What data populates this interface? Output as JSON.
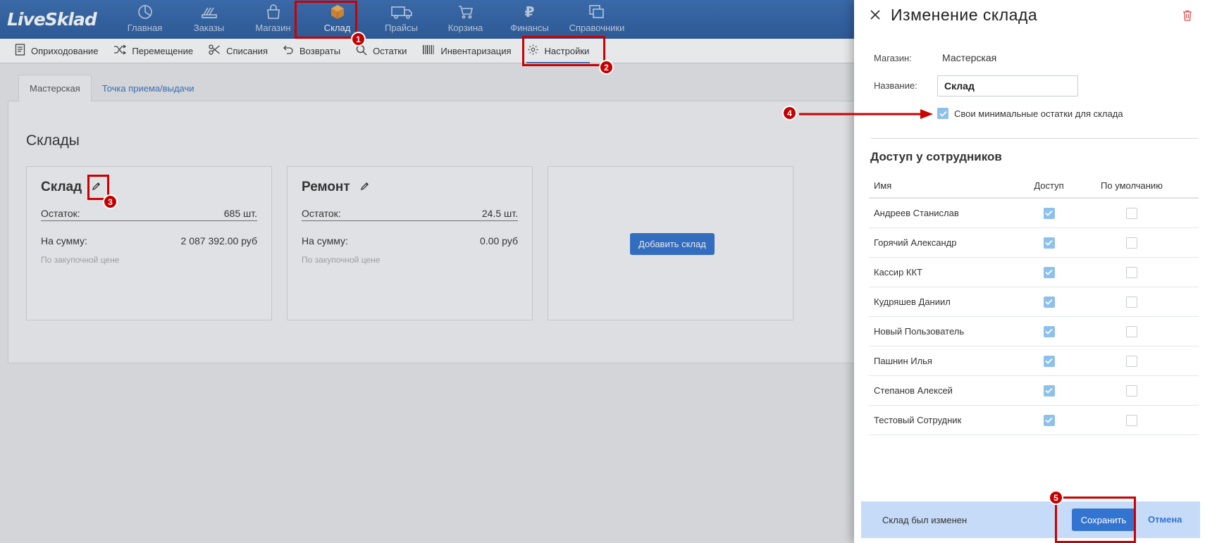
{
  "app": {
    "logo": "LiveSklad"
  },
  "topnav": {
    "items": [
      {
        "label": "Главная",
        "icon": "dashboard-pie-icon"
      },
      {
        "label": "Заказы",
        "icon": "orders-stack-icon"
      },
      {
        "label": "Магазин",
        "icon": "shopping-bag-icon"
      },
      {
        "label": "Склад",
        "icon": "box-icon"
      },
      {
        "label": "Прайсы",
        "icon": "truck-icon"
      },
      {
        "label": "Корзина",
        "icon": "cart-icon"
      },
      {
        "label": "Финансы",
        "icon": "ruble-icon"
      },
      {
        "label": "Справочники",
        "icon": "directory-icon"
      }
    ]
  },
  "subnav": {
    "items": [
      {
        "label": "Оприходование",
        "icon": "receipt-icon"
      },
      {
        "label": "Перемещение",
        "icon": "shuffle-icon"
      },
      {
        "label": "Списания",
        "icon": "scissors-icon"
      },
      {
        "label": "Возвраты",
        "icon": "return-icon"
      },
      {
        "label": "Остатки",
        "icon": "search-icon"
      },
      {
        "label": "Инвентаризация",
        "icon": "barcode-icon"
      },
      {
        "label": "Настройки",
        "icon": "gear-icon"
      }
    ]
  },
  "tabs": [
    "Мастерская",
    "Точка приема/выдачи"
  ],
  "warehouses": {
    "title": "Склады",
    "cards": [
      {
        "name": "Склад",
        "stock_label": "Остаток:",
        "stock_value": "685 шт.",
        "sum_label": "На сумму:",
        "sum_value": "2 087 392.00 руб",
        "hint": "По закупочной цене"
      },
      {
        "name": "Ремонт",
        "stock_label": "Остаток:",
        "stock_value": "24.5 шт.",
        "sum_label": "На сумму:",
        "sum_value": "0.00 руб",
        "hint": "По закупочной цене"
      }
    ],
    "add_label": "Добавить склад"
  },
  "drawer": {
    "title": "Изменение склада",
    "shop_label": "Магазин:",
    "shop_value": "Мастерская",
    "name_label": "Название:",
    "name_value": "Склад",
    "min_stock_label": "Свои минимальные остатки для склада",
    "access_title": "Доступ у сотрудников",
    "columns": {
      "name": "Имя",
      "access": "Доступ",
      "default": "По умолчанию"
    },
    "employees": [
      {
        "name": "Андреев Станислав",
        "access": true,
        "default": false
      },
      {
        "name": "Горячий Александр",
        "access": true,
        "default": false
      },
      {
        "name": "Кассир ККТ",
        "access": true,
        "default": false
      },
      {
        "name": "Кудряшев Даниил",
        "access": true,
        "default": false
      },
      {
        "name": "Новый Пользователь",
        "access": true,
        "default": false
      },
      {
        "name": "Пашнин Илья",
        "access": true,
        "default": false
      },
      {
        "name": "Степанов Алексей",
        "access": true,
        "default": false
      },
      {
        "name": "Тестовый Сотрудник",
        "access": true,
        "default": false
      }
    ],
    "status": "Склад был изменен",
    "save_label": "Сохранить",
    "cancel_label": "Отмена"
  },
  "annotations": [
    "1",
    "2",
    "3",
    "4",
    "5"
  ],
  "colors": {
    "brand": "#3a6fb5",
    "primary_button": "#3274d0",
    "highlight": "#cc0000",
    "checkbox_on": "#8ec0ec"
  }
}
